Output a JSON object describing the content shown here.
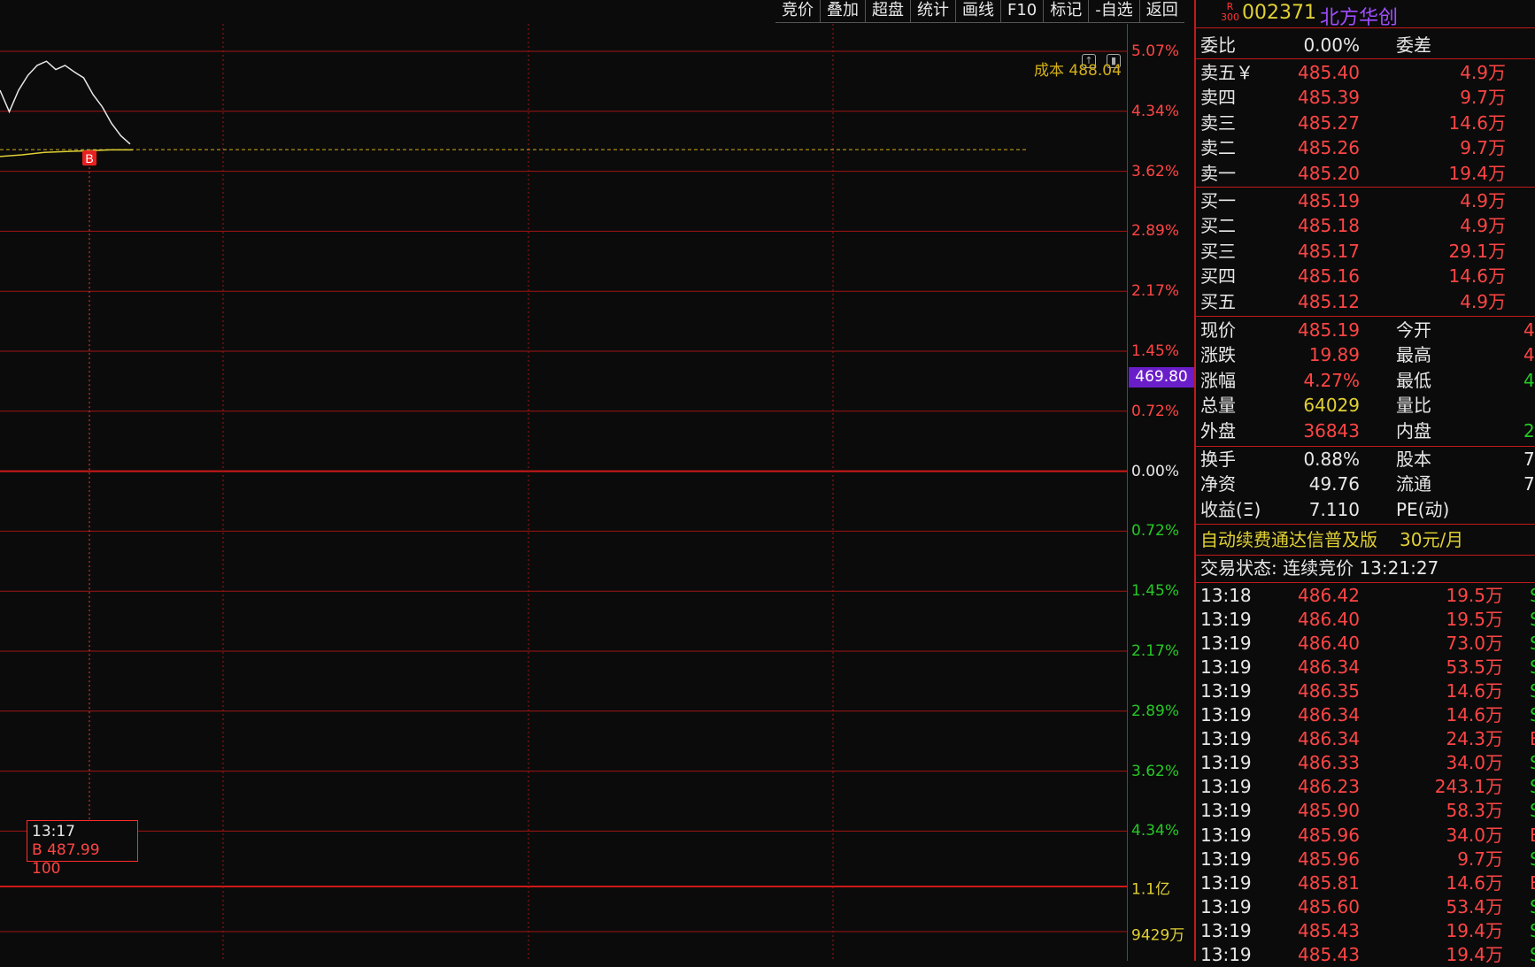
{
  "toolbar": {
    "items": [
      "竞价",
      "叠加",
      "超盘",
      "统计",
      "画线",
      "F10",
      "标记",
      "-自选",
      "返回"
    ]
  },
  "chart": {
    "y_labels_top": [
      {
        "text": "5.07%",
        "color": "red"
      },
      {
        "text": "4.34%",
        "color": "red"
      },
      {
        "text": "3.62%",
        "color": "red"
      },
      {
        "text": "2.89%",
        "color": "red"
      },
      {
        "text": "2.17%",
        "color": "red"
      },
      {
        "text": "1.45%",
        "color": "red"
      },
      {
        "text": "0.72%",
        "color": "red"
      },
      {
        "text": "0.00%",
        "color": "white"
      },
      {
        "text": "0.72%",
        "color": "green"
      },
      {
        "text": "1.45%",
        "color": "green"
      },
      {
        "text": "2.17%",
        "color": "green"
      },
      {
        "text": "2.89%",
        "color": "green"
      },
      {
        "text": "3.62%",
        "color": "green"
      },
      {
        "text": "4.34%",
        "color": "green"
      }
    ],
    "y_labels_volume": [
      {
        "text": "1.1亿"
      },
      {
        "text": "9429万"
      }
    ],
    "prev_close_tag": "469.80",
    "cost_label": "成本 488.04",
    "buy_marker": "B",
    "tooltip": {
      "time": "13:17",
      "line": "B 487.99  100"
    },
    "price_line_pct": [
      4.6,
      4.34,
      4.6,
      4.78,
      4.9,
      4.95,
      4.85,
      4.9,
      4.82,
      4.75,
      4.55,
      4.4,
      4.2,
      4.05,
      3.95
    ],
    "avg_line_pct": [
      3.8,
      3.82,
      3.85,
      3.86,
      3.87,
      3.88,
      3.88
    ]
  },
  "stock": {
    "badge_top": "R",
    "badge_bottom": "300",
    "code": "002371",
    "name": "北方华创"
  },
  "weibi": {
    "label": "委比",
    "value": "0.00%",
    "label2": "委差"
  },
  "sell": [
    {
      "label": "卖五￥",
      "price": "485.40",
      "vol": "4.9万"
    },
    {
      "label": "卖四",
      "price": "485.39",
      "vol": "9.7万"
    },
    {
      "label": "卖三",
      "price": "485.27",
      "vol": "14.6万"
    },
    {
      "label": "卖二",
      "price": "485.26",
      "vol": "9.7万"
    },
    {
      "label": "卖一",
      "price": "485.20",
      "vol": "19.4万"
    }
  ],
  "buy": [
    {
      "label": "买一",
      "price": "485.19",
      "vol": "4.9万"
    },
    {
      "label": "买二",
      "price": "485.18",
      "vol": "4.9万"
    },
    {
      "label": "买三",
      "price": "485.17",
      "vol": "29.1万"
    },
    {
      "label": "买四",
      "price": "485.16",
      "vol": "14.6万"
    },
    {
      "label": "买五",
      "price": "485.12",
      "vol": "4.9万"
    }
  ],
  "quote": [
    {
      "label": "现价",
      "value": "485.19",
      "vcolor": "red",
      "label2": "今开",
      "v2": "4",
      "v2color": "red"
    },
    {
      "label": "涨跌",
      "value": "19.89",
      "vcolor": "red",
      "label2": "最高",
      "v2": "4",
      "v2color": "red"
    },
    {
      "label": "涨幅",
      "value": "4.27%",
      "vcolor": "red",
      "label2": "最低",
      "v2": "4",
      "v2color": "green"
    },
    {
      "label": "总量",
      "value": "64029",
      "vcolor": "yellow",
      "label2": "量比",
      "v2": "",
      "v2color": "white"
    },
    {
      "label": "外盘",
      "value": "36843",
      "vcolor": "red",
      "label2": "内盘",
      "v2": "2",
      "v2color": "green"
    }
  ],
  "stats": [
    {
      "label": "换手",
      "value": "0.88%",
      "label2": "股本",
      "v2": "7"
    },
    {
      "label": "净资",
      "value": "49.76",
      "label2": "流通",
      "v2": "7"
    },
    {
      "label": "收益(Ξ)",
      "value": "7.110",
      "label2": "PE(动)",
      "v2": ""
    }
  ],
  "ad": {
    "text": "自动续费通达信普及版",
    "price": "30元/月"
  },
  "status": {
    "text": "交易状态: 连续竞价 13:21:27"
  },
  "ticks": [
    {
      "time": "13:18",
      "price": "486.42",
      "vol": "19.5万",
      "flag": "S",
      "fcolor": "green"
    },
    {
      "time": "13:19",
      "price": "486.40",
      "vol": "19.5万",
      "flag": "S",
      "fcolor": "green"
    },
    {
      "time": "13:19",
      "price": "486.40",
      "vol": "73.0万",
      "flag": "S",
      "fcolor": "green"
    },
    {
      "time": "13:19",
      "price": "486.34",
      "vol": "53.5万",
      "flag": "S",
      "fcolor": "green"
    },
    {
      "time": "13:19",
      "price": "486.35",
      "vol": "14.6万",
      "flag": "S",
      "fcolor": "green"
    },
    {
      "time": "13:19",
      "price": "486.34",
      "vol": "14.6万",
      "flag": "S",
      "fcolor": "green"
    },
    {
      "time": "13:19",
      "price": "486.34",
      "vol": "24.3万",
      "flag": "B",
      "fcolor": "red"
    },
    {
      "time": "13:19",
      "price": "486.33",
      "vol": "34.0万",
      "flag": "S",
      "fcolor": "green"
    },
    {
      "time": "13:19",
      "price": "486.23",
      "vol": "243.1万",
      "flag": "S",
      "fcolor": "green"
    },
    {
      "time": "13:19",
      "price": "485.90",
      "vol": "58.3万",
      "flag": "S",
      "fcolor": "green"
    },
    {
      "time": "13:19",
      "price": "485.96",
      "vol": "34.0万",
      "flag": "B",
      "fcolor": "red"
    },
    {
      "time": "13:19",
      "price": "485.96",
      "vol": "9.7万",
      "flag": "S",
      "fcolor": "green"
    },
    {
      "time": "13:19",
      "price": "485.81",
      "vol": "14.6万",
      "flag": "B",
      "fcolor": "red"
    },
    {
      "time": "13:19",
      "price": "485.60",
      "vol": "53.4万",
      "flag": "S",
      "fcolor": "green"
    },
    {
      "time": "13:19",
      "price": "485.43",
      "vol": "19.4万",
      "flag": "S",
      "fcolor": "green"
    },
    {
      "time": "13:19",
      "price": "485.43",
      "vol": "19.4万",
      "flag": "S",
      "fcolor": "green"
    }
  ],
  "colors": {
    "red": "#ff4545",
    "green": "#26c826",
    "yellow": "#e0d034",
    "purple": "#a14dff",
    "grid": "#a01414"
  }
}
